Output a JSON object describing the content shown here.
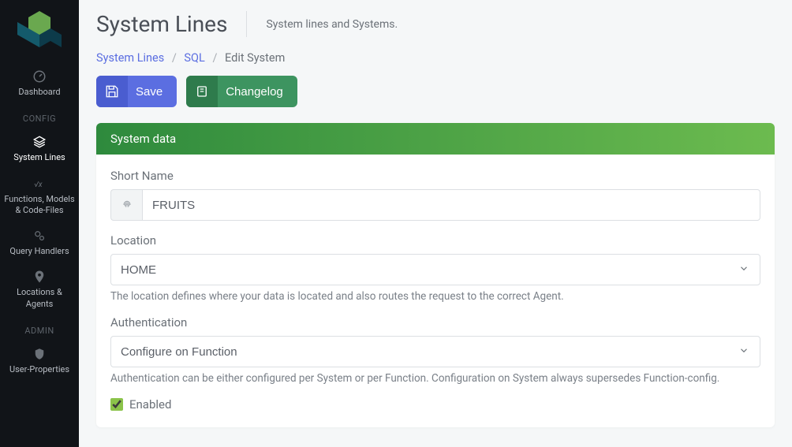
{
  "sidebar": {
    "items": [
      {
        "label": "Dashboard"
      },
      {
        "label": "System Lines"
      },
      {
        "label": "Functions, Models & Code-Files"
      },
      {
        "label": "Query Handlers"
      },
      {
        "label": "Locations & Agents"
      },
      {
        "label": "User-Properties"
      }
    ],
    "sections": {
      "config": "CONFIG",
      "admin": "ADMIN"
    }
  },
  "header": {
    "title": "System Lines",
    "subtitle": "System lines and Systems."
  },
  "breadcrumb": {
    "item1": "System Lines",
    "item2": "SQL",
    "item3": "Edit System"
  },
  "actions": {
    "save": "Save",
    "changelog": "Changelog"
  },
  "card": {
    "title": "System data",
    "shortName": {
      "label": "Short Name",
      "value": "FRUITS"
    },
    "location": {
      "label": "Location",
      "value": "HOME",
      "help": "The location defines where your data is located and also routes the request to the correct Agent."
    },
    "authentication": {
      "label": "Authentication",
      "value": "Configure on Function",
      "help": "Authentication can be either configured per System or per Function. Configuration on System always supersedes Function-config."
    },
    "enabled": {
      "label": "Enabled",
      "checked": true
    }
  }
}
